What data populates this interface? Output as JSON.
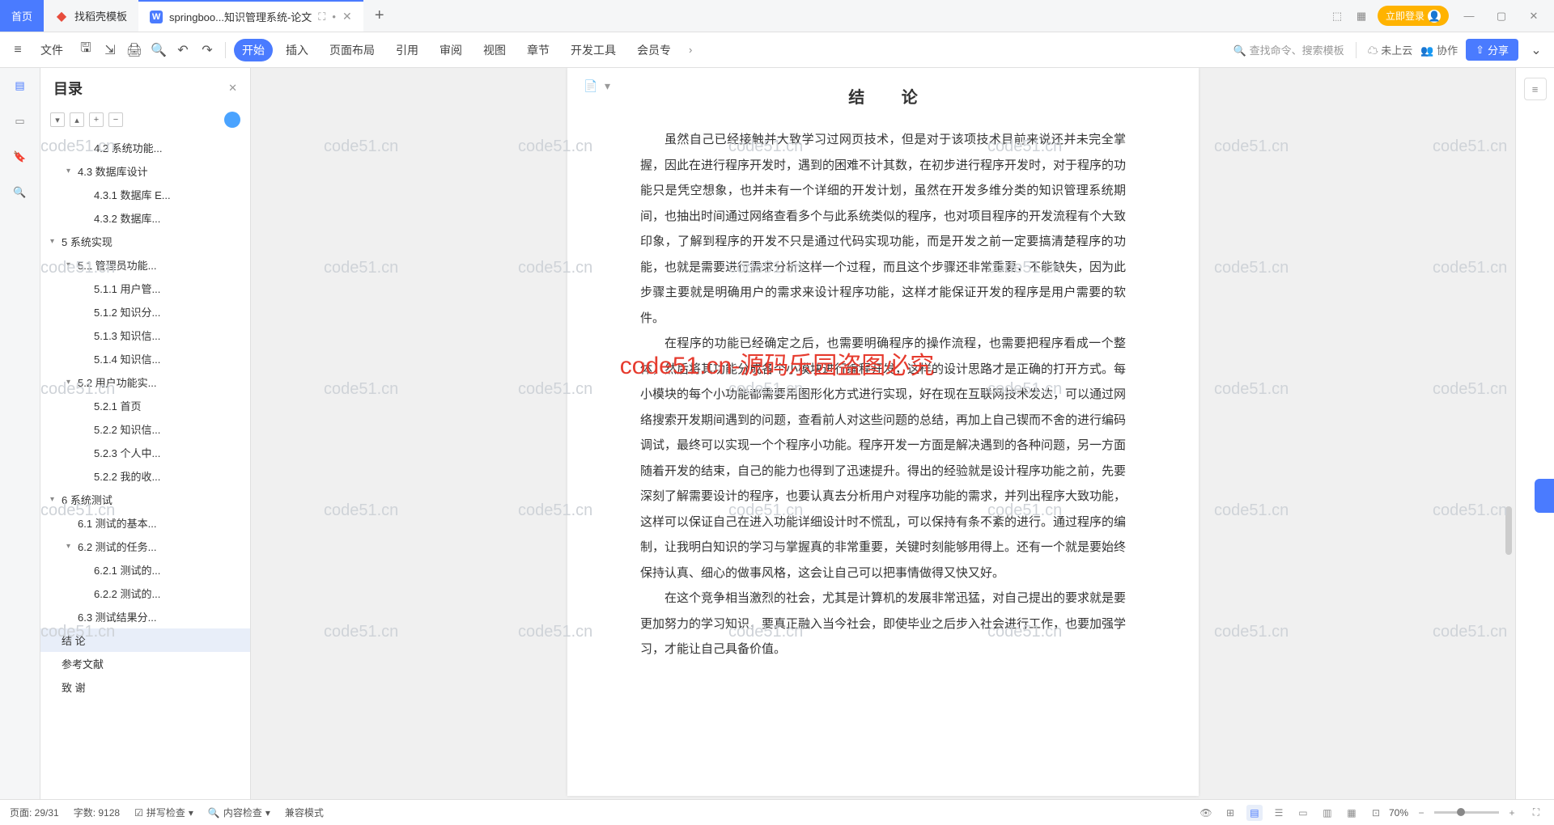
{
  "titlebar": {
    "tabs": [
      {
        "label": "首页",
        "type": "home"
      },
      {
        "label": "找稻壳模板",
        "type": "docao"
      },
      {
        "label": "springboo...知识管理系统-论文",
        "type": "doc"
      }
    ],
    "login": "立即登录"
  },
  "toolbar": {
    "file": "文件",
    "menus": [
      "开始",
      "插入",
      "页面布局",
      "引用",
      "审阅",
      "视图",
      "章节",
      "开发工具",
      "会员专"
    ],
    "search": "查找命令、搜索模板",
    "cloud": "未上云",
    "collab": "协作",
    "share": "分享"
  },
  "sidebar": {
    "title": "目录",
    "items": [
      {
        "label": "4.2 系统功能...",
        "level": 3,
        "chev": ""
      },
      {
        "label": "4.3 数据库设计",
        "level": 2,
        "chev": "▾"
      },
      {
        "label": "4.3.1 数据库 E...",
        "level": 3,
        "chev": ""
      },
      {
        "label": "4.3.2 数据库...",
        "level": 3,
        "chev": ""
      },
      {
        "label": "5 系统实现",
        "level": 1,
        "chev": "▾"
      },
      {
        "label": "5.1 管理员功能...",
        "level": 2,
        "chev": "▾"
      },
      {
        "label": "5.1.1 用户管...",
        "level": 3,
        "chev": ""
      },
      {
        "label": "5.1.2 知识分...",
        "level": 3,
        "chev": ""
      },
      {
        "label": "5.1.3 知识信...",
        "level": 3,
        "chev": ""
      },
      {
        "label": "5.1.4 知识信...",
        "level": 3,
        "chev": ""
      },
      {
        "label": "5.2 用户功能实...",
        "level": 2,
        "chev": "▾"
      },
      {
        "label": "5.2.1 首页",
        "level": 3,
        "chev": ""
      },
      {
        "label": "5.2.2 知识信...",
        "level": 3,
        "chev": ""
      },
      {
        "label": "5.2.3 个人中...",
        "level": 3,
        "chev": ""
      },
      {
        "label": "5.2.2 我的收...",
        "level": 3,
        "chev": ""
      },
      {
        "label": "6 系统测试",
        "level": 1,
        "chev": "▾"
      },
      {
        "label": "6.1 测试的基本...",
        "level": 2,
        "chev": ""
      },
      {
        "label": "6.2 测试的任务...",
        "level": 2,
        "chev": "▾"
      },
      {
        "label": "6.2.1 测试的...",
        "level": 3,
        "chev": ""
      },
      {
        "label": "6.2.2 测试的...",
        "level": 3,
        "chev": ""
      },
      {
        "label": "6.3 测试结果分...",
        "level": 2,
        "chev": ""
      },
      {
        "label": "结   论",
        "level": 1,
        "chev": "",
        "selected": true
      },
      {
        "label": "参考文献",
        "level": 1,
        "chev": ""
      },
      {
        "label": "致   谢",
        "level": 1,
        "chev": ""
      }
    ]
  },
  "document": {
    "title": "结   论",
    "p1": "虽然自己已经接触并大致学习过网页技术，但是对于该项技术目前来说还并未完全掌握，因此在进行程序开发时，遇到的困难不计其数，在初步进行程序开发时，对于程序的功能只是凭空想象，也并未有一个详细的开发计划，虽然在开发多维分类的知识管理系统期间，也抽出时间通过网络查看多个与此系统类似的程序，也对项目程序的开发流程有个大致印象，了解到程序的开发不只是通过代码实现功能，而是开发之前一定要搞清楚程序的功能，也就是需要进行需求分析这样一个过程，而且这个步骤还非常重要，不能缺失，因为此步骤主要就是明确用户的需求来设计程序功能，这样才能保证开发的程序是用户需要的软件。",
    "p2": "在程序的功能已经确定之后，也需要明确程序的操作流程，也需要把程序看成一个整体，然后将其功能分成各个小模块进行编程开发，这样的设计思路才是正确的打开方式。每小模块的每个小功能都需要用图形化方式进行实现，好在现在互联网技术发达，可以通过网络搜索开发期间遇到的问题，查看前人对这些问题的总结，再加上自己锲而不舍的进行编码调试，最终可以实现一个个程序小功能。程序开发一方面是解决遇到的各种问题，另一方面随着开发的结束，自己的能力也得到了迅速提升。得出的经验就是设计程序功能之前，先要深刻了解需要设计的程序，也要认真去分析用户对程序功能的需求，并列出程序大致功能，这样可以保证自己在进入功能详细设计时不慌乱，可以保持有条不紊的进行。通过程序的编制，让我明白知识的学习与掌握真的非常重要，关键时刻能够用得上。还有一个就是要始终保持认真、细心的做事风格，这会让自己可以把事情做得又快又好。",
    "p3": "在这个竞争相当激烈的社会，尤其是计算机的发展非常迅猛，对自己提出的要求就是要更加努力的学习知识，要真正融入当今社会，即使毕业之后步入社会进行工作，也要加强学习，才能让自己具备价值。"
  },
  "watermark": {
    "gray": "code51.cn",
    "red": "code51.cn-源码乐园盗图必究"
  },
  "statusbar": {
    "page": "页面: 29/31",
    "words": "字数: 9128",
    "spell": "拼写检查",
    "content": "内容检查",
    "compat": "兼容模式",
    "zoom": "70%"
  }
}
